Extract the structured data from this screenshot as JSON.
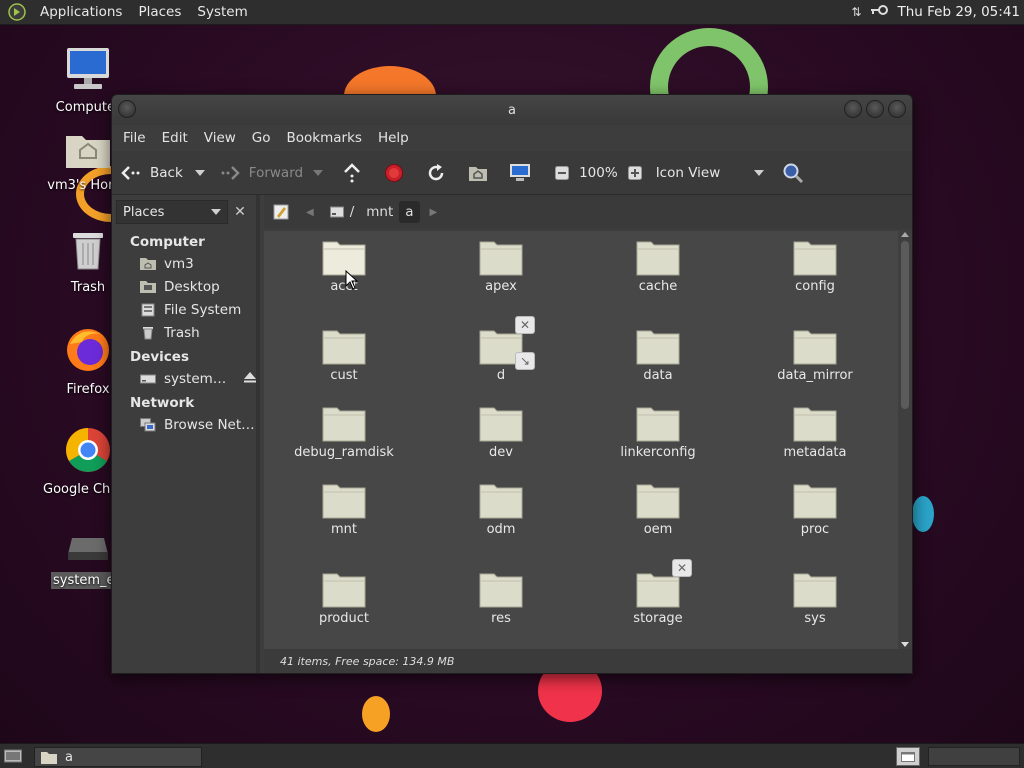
{
  "top_panel": {
    "menus": [
      "Applications",
      "Places",
      "System"
    ],
    "datetime": "Thu Feb 29, 05:41"
  },
  "desktop": {
    "icons": [
      {
        "label": "Computer",
        "icon": "computer-icon"
      },
      {
        "label": "vm3's Home",
        "icon": "home-folder-icon"
      },
      {
        "label": "Trash",
        "icon": "trash-icon"
      },
      {
        "label": "Firefox",
        "icon": "firefox-icon"
      },
      {
        "label": "Google Chrome",
        "icon": "chrome-icon"
      },
      {
        "label": "system_ext",
        "icon": "drive-icon"
      }
    ]
  },
  "window": {
    "title": "a",
    "menubar": [
      "File",
      "Edit",
      "View",
      "Go",
      "Bookmarks",
      "Help"
    ],
    "toolbar": {
      "back": "Back",
      "forward": "Forward",
      "zoom": "100%",
      "view_mode": "Icon View"
    },
    "sidebar": {
      "combo": "Places",
      "sections": [
        {
          "heading": "Computer",
          "items": [
            {
              "label": "vm3",
              "icon": "home-icon"
            },
            {
              "label": "Desktop",
              "icon": "desktop-icon"
            },
            {
              "label": "File System",
              "icon": "filesystem-icon"
            },
            {
              "label": "Trash",
              "icon": "trash-icon"
            }
          ]
        },
        {
          "heading": "Devices",
          "items": [
            {
              "label": "system…",
              "icon": "drive-icon"
            }
          ]
        },
        {
          "heading": "Network",
          "items": [
            {
              "label": "Browse Net…",
              "icon": "network-icon"
            }
          ]
        }
      ]
    },
    "path": [
      "/",
      "mnt",
      "a"
    ],
    "files": [
      {
        "name": "acct"
      },
      {
        "name": "apex"
      },
      {
        "name": "cache"
      },
      {
        "name": "config"
      },
      {
        "name": "cust"
      },
      {
        "name": "d",
        "emblem": "symlink-unreadable"
      },
      {
        "name": "data"
      },
      {
        "name": "data_mirror"
      },
      {
        "name": "debug_ramdisk"
      },
      {
        "name": "dev"
      },
      {
        "name": "linkerconfig"
      },
      {
        "name": "metadata"
      },
      {
        "name": "mnt"
      },
      {
        "name": "odm"
      },
      {
        "name": "oem"
      },
      {
        "name": "proc"
      },
      {
        "name": "product"
      },
      {
        "name": "res"
      },
      {
        "name": "storage",
        "emblem": "unreadable"
      },
      {
        "name": "sys"
      }
    ],
    "status": "41 items, Free space: 134.9 MB"
  },
  "bottom_panel": {
    "task_label": "a"
  },
  "colors": {
    "panel_bg": "#2e2e2e",
    "window_bg": "#3d3d3d",
    "icon_view_bg": "#474747",
    "folder": "#dcdccb"
  }
}
